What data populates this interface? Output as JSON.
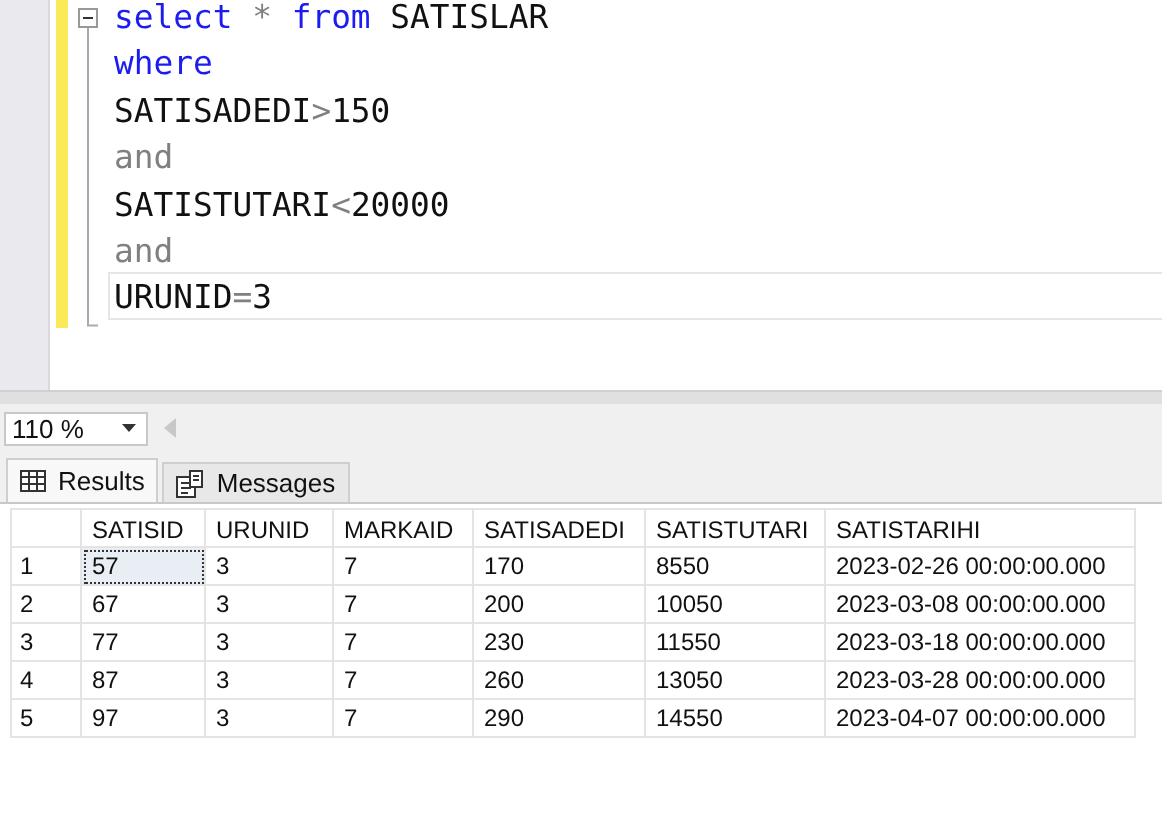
{
  "editor": {
    "outline_expanded": true,
    "lines": [
      {
        "changed": true,
        "current": false,
        "tokens": [
          {
            "kind": "keyword",
            "text": "select"
          },
          {
            "kind": "operator",
            "text": " * "
          },
          {
            "kind": "keyword",
            "text": "from"
          },
          {
            "kind": "plain",
            "text": " SATISLAR"
          }
        ]
      },
      {
        "changed": true,
        "current": false,
        "tokens": [
          {
            "kind": "keyword",
            "text": "where"
          }
        ]
      },
      {
        "changed": true,
        "current": false,
        "tokens": [
          {
            "kind": "plain",
            "text": "SATISADEDI"
          },
          {
            "kind": "operator",
            "text": ">"
          },
          {
            "kind": "plain",
            "text": "150"
          }
        ]
      },
      {
        "changed": true,
        "current": false,
        "tokens": [
          {
            "kind": "operator",
            "text": "and"
          }
        ]
      },
      {
        "changed": true,
        "current": false,
        "tokens": [
          {
            "kind": "plain",
            "text": "SATISTUTARI"
          },
          {
            "kind": "operator",
            "text": "<"
          },
          {
            "kind": "plain",
            "text": "20000"
          }
        ]
      },
      {
        "changed": true,
        "current": false,
        "tokens": [
          {
            "kind": "operator",
            "text": "and"
          }
        ]
      },
      {
        "changed": true,
        "current": true,
        "tokens": [
          {
            "kind": "plain",
            "text": "URUNID"
          },
          {
            "kind": "operator",
            "text": "="
          },
          {
            "kind": "plain",
            "text": "3"
          }
        ]
      }
    ]
  },
  "zoom": {
    "value": "110 %"
  },
  "tabs": [
    {
      "label": "Results",
      "kind": "grid",
      "selected": true
    },
    {
      "label": "Messages",
      "kind": "messages",
      "selected": false
    }
  ],
  "table": {
    "columns": [
      "SATISID",
      "URUNID",
      "MARKAID",
      "SATISADEDI",
      "SATISTUTARI",
      "SATISTARIHI"
    ],
    "rows": [
      {
        "number": "1",
        "cells": [
          {
            "text": "57",
            "selected": true
          },
          {
            "text": "3",
            "selected": false
          },
          {
            "text": "7",
            "selected": false
          },
          {
            "text": "170",
            "selected": false
          },
          {
            "text": "8550",
            "selected": false
          },
          {
            "text": "2023-02-26 00:00:00.000",
            "selected": false
          }
        ]
      },
      {
        "number": "2",
        "cells": [
          {
            "text": "67",
            "selected": false
          },
          {
            "text": "3",
            "selected": false
          },
          {
            "text": "7",
            "selected": false
          },
          {
            "text": "200",
            "selected": false
          },
          {
            "text": "10050",
            "selected": false
          },
          {
            "text": "2023-03-08 00:00:00.000",
            "selected": false
          }
        ]
      },
      {
        "number": "3",
        "cells": [
          {
            "text": "77",
            "selected": false
          },
          {
            "text": "3",
            "selected": false
          },
          {
            "text": "7",
            "selected": false
          },
          {
            "text": "230",
            "selected": false
          },
          {
            "text": "11550",
            "selected": false
          },
          {
            "text": "2023-03-18 00:00:00.000",
            "selected": false
          }
        ]
      },
      {
        "number": "4",
        "cells": [
          {
            "text": "87",
            "selected": false
          },
          {
            "text": "3",
            "selected": false
          },
          {
            "text": "7",
            "selected": false
          },
          {
            "text": "260",
            "selected": false
          },
          {
            "text": "13050",
            "selected": false
          },
          {
            "text": "2023-03-28 00:00:00.000",
            "selected": false
          }
        ]
      },
      {
        "number": "5",
        "cells": [
          {
            "text": "97",
            "selected": false
          },
          {
            "text": "3",
            "selected": false
          },
          {
            "text": "7",
            "selected": false
          },
          {
            "text": "290",
            "selected": false
          },
          {
            "text": "14550",
            "selected": false
          },
          {
            "text": "2023-04-07 00:00:00.000",
            "selected": false
          }
        ]
      }
    ]
  }
}
